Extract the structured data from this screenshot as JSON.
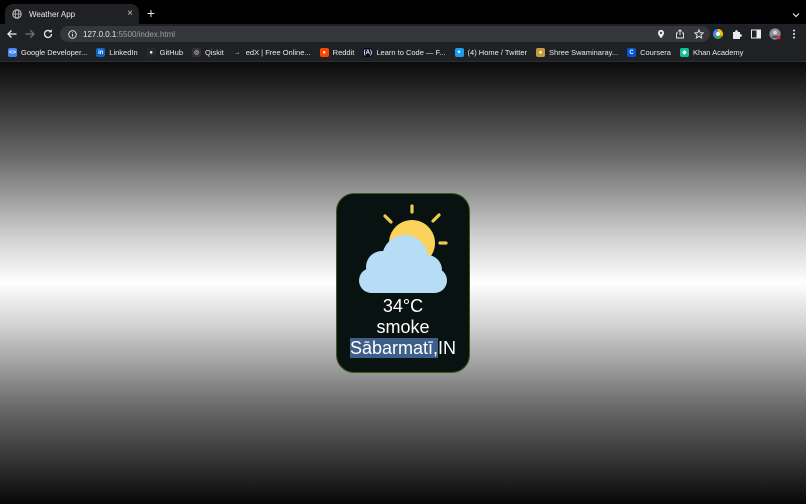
{
  "browser": {
    "tab": {
      "title": "Weather App",
      "close": "×"
    },
    "new_tab": "+",
    "address": {
      "host": "127.0.0.1",
      "rest": ":5500/index.html"
    },
    "bookmarks": [
      {
        "label": "Google Developer...",
        "icon": "google-developers-icon",
        "color": "#4285f4",
        "glyph": "<>"
      },
      {
        "label": "LinkedIn",
        "icon": "linkedin-icon",
        "color": "#0a66c2",
        "glyph": "in"
      },
      {
        "label": "GitHub",
        "icon": "github-icon",
        "color": "#24292f",
        "glyph": "●"
      },
      {
        "label": "Qiskit",
        "icon": "qiskit-icon",
        "color": "#333333",
        "glyph": "◎"
      },
      {
        "label": "edX | Free Online...",
        "icon": "edx-icon",
        "color": "#202124",
        "glyph": "→"
      },
      {
        "label": "Reddit",
        "icon": "reddit-icon",
        "color": "#ff4500",
        "glyph": "●"
      },
      {
        "label": "Learn to Code — F...",
        "icon": "freecodecamp-icon",
        "color": "#0a0a23",
        "glyph": "(A)"
      },
      {
        "label": "(4) Home / Twitter",
        "icon": "twitter-icon",
        "color": "#1d9bf0",
        "glyph": "✦"
      },
      {
        "label": "Shree Swaminaray...",
        "icon": "swaminarayan-icon",
        "color": "#c49a3c",
        "glyph": "●"
      },
      {
        "label": "Coursera",
        "icon": "coursera-icon",
        "color": "#0056d2",
        "glyph": "C"
      },
      {
        "label": "Khan Academy",
        "icon": "khan-academy-icon",
        "color": "#14bf96",
        "glyph": "◆"
      }
    ]
  },
  "weather": {
    "temperature": "34°C",
    "description": "smoke",
    "location_selected": "Sābarmatī,",
    "location_rest": "IN",
    "icon": "sun-behind-cloud-icon"
  }
}
